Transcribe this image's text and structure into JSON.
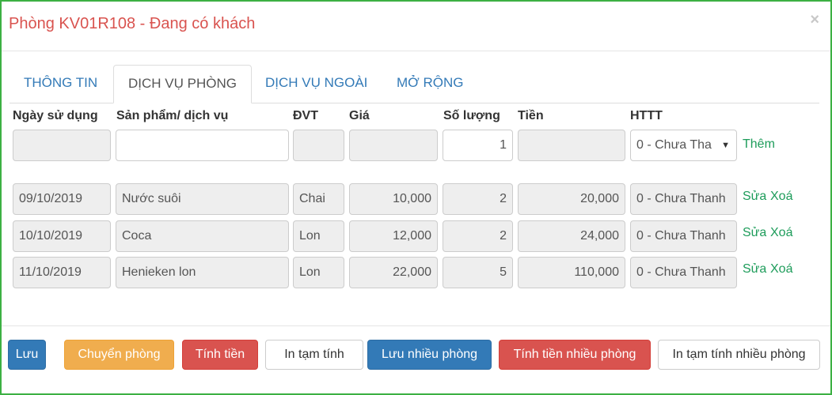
{
  "header": {
    "title": "Phòng KV01R108 - Đang có khách",
    "close_label": "×"
  },
  "tabs": [
    {
      "label": "THÔNG TIN",
      "active": false
    },
    {
      "label": "DỊCH VỤ PHÒNG",
      "active": true
    },
    {
      "label": "DỊCH VỤ NGOÀI",
      "active": false
    },
    {
      "label": "MỞ RỘNG",
      "active": false
    }
  ],
  "columns": {
    "date": "Ngày sử dụng",
    "product": "Sản phẩm/ dịch vụ",
    "unit": "ĐVT",
    "price": "Giá",
    "qty": "Số lượng",
    "amount": "Tiền",
    "payment": "HTTT"
  },
  "new_row": {
    "date": "",
    "product": "",
    "unit": "",
    "price": "",
    "qty": "1",
    "amount": "",
    "payment": "0 - Chưa Tha",
    "add_label": "Thêm"
  },
  "rows": [
    {
      "date": "09/10/2019",
      "product": "Nước suôi",
      "unit": "Chai",
      "price": "10,000",
      "qty": "2",
      "amount": "20,000",
      "payment": "0 - Chưa Thanh",
      "edit_label": "Sửa",
      "delete_label": "Xoá"
    },
    {
      "date": "10/10/2019",
      "product": "Coca",
      "unit": "Lon",
      "price": "12,000",
      "qty": "2",
      "amount": "24,000",
      "payment": "0 - Chưa Thanh",
      "edit_label": "Sửa",
      "delete_label": "Xoá"
    },
    {
      "date": "11/10/2019",
      "product": "Henieken lon",
      "unit": "Lon",
      "price": "22,000",
      "qty": "5",
      "amount": "110,000",
      "payment": "0 - Chưa Thanh",
      "edit_label": "Sửa",
      "delete_label": "Xoá"
    }
  ],
  "footer": {
    "save": "Lưu",
    "move_room": "Chuyển phòng",
    "checkout": "Tính tiền",
    "print_temp": "In tạm tính",
    "save_multi": "Lưu nhiều phòng",
    "checkout_multi": "Tính tiền nhiều phòng",
    "print_temp_multi": "In tạm tính nhiều phòng"
  },
  "colors": {
    "border": "#3cb043",
    "title": "#d9534f",
    "link_green": "#1d9c5a",
    "primary": "#337ab7",
    "warning": "#f0ad4e",
    "danger": "#d9534f"
  }
}
